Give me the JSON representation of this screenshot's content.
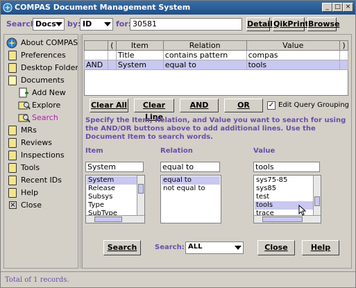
{
  "window": {
    "title": "COMPAS Document Management System"
  },
  "toolbar": {
    "search_label": "Search:",
    "search_value": "Docs",
    "by_label": "by:",
    "by_value": "ID",
    "for_label": "for:",
    "for_value": "30581",
    "detail": "Detail",
    "qikprint": "QikPrint",
    "browse": "Browse"
  },
  "sidebar": {
    "items": [
      {
        "label": "About COMPAS"
      },
      {
        "label": "Preferences"
      },
      {
        "label": "Desktop Folders"
      },
      {
        "label": "Documents"
      },
      {
        "label": "Add New"
      },
      {
        "label": "Explore"
      },
      {
        "label": "Search"
      },
      {
        "label": "MRs"
      },
      {
        "label": "Reviews"
      },
      {
        "label": "Inspections"
      },
      {
        "label": "Tools"
      },
      {
        "label": "Recent IDs"
      },
      {
        "label": "Help"
      },
      {
        "label": "Close"
      }
    ]
  },
  "query": {
    "headers": [
      "",
      "(",
      "Item",
      "Relation",
      "Value",
      ")"
    ],
    "rows": [
      {
        "op": "",
        "open": "",
        "item": "Title",
        "relation": "contains pattern",
        "value": "compas",
        "close": ""
      },
      {
        "op": "AND",
        "open": "",
        "item": "System",
        "relation": "equal to",
        "value": "tools",
        "close": ""
      }
    ]
  },
  "buttons": {
    "clear_all": "Clear All",
    "clear_line": "Clear Line",
    "and": "AND",
    "or": "OR",
    "edit_grouping": "Edit Query Grouping"
  },
  "help_text": "Specify the Item, Relation, and Value you want to search for using the AND/OR buttons above to add additional lines.  Use the Document Item to search words.",
  "columns": {
    "item_header": "Item",
    "relation_header": "Relation",
    "value_header": "Value",
    "item_input": "System",
    "relation_input": "equal to",
    "value_input": "tools",
    "item_list": [
      "System",
      "Release",
      "Subsys",
      "Type",
      "SubType"
    ],
    "relation_list": [
      "equal to",
      "not equal to"
    ],
    "value_list": [
      "sys75-85",
      "sys85",
      "test",
      "tools",
      "trace"
    ]
  },
  "bottom": {
    "search_button": "Search",
    "search_label": "Search:",
    "search_scope": "ALL",
    "close_button": "Close",
    "help_button": "Help"
  },
  "status": {
    "text": "Total of 1 records."
  }
}
